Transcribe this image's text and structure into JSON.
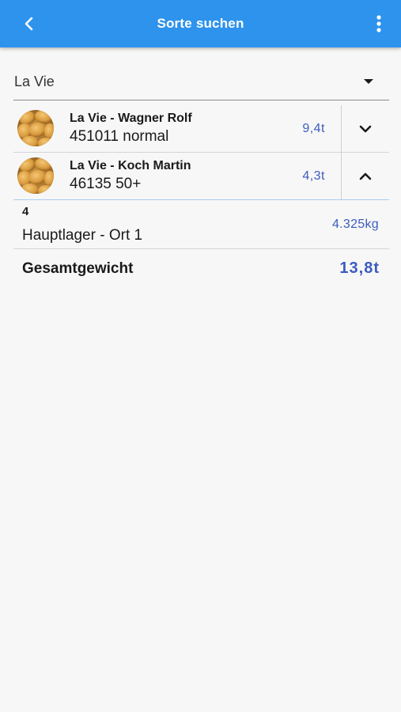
{
  "appbar": {
    "title": "Sorte suchen",
    "back_icon": "arrow-back-icon",
    "menu_icon": "more-vertical-icon",
    "color": "#2e93ec"
  },
  "variety_select": {
    "value": "La Vie"
  },
  "items": [
    {
      "name": "La Vie - Wagner Rolf",
      "sub": "451011 normal",
      "weight": "9,4t",
      "expanded": false,
      "toggle_icon": "chevron-down-icon"
    },
    {
      "name": "La Vie - Koch Martin",
      "sub": "46135 50+",
      "weight": "4,3t",
      "expanded": true,
      "toggle_icon": "chevron-up-icon",
      "details": [
        {
          "number": "4",
          "location": "Hauptlager - Ort 1",
          "weight": "4.325kg"
        }
      ]
    }
  ],
  "total": {
    "label": "Gesamtgewicht",
    "value": "13,8t"
  },
  "colors": {
    "accent_text": "#3c5cbf",
    "background": "#f7f7f7"
  }
}
